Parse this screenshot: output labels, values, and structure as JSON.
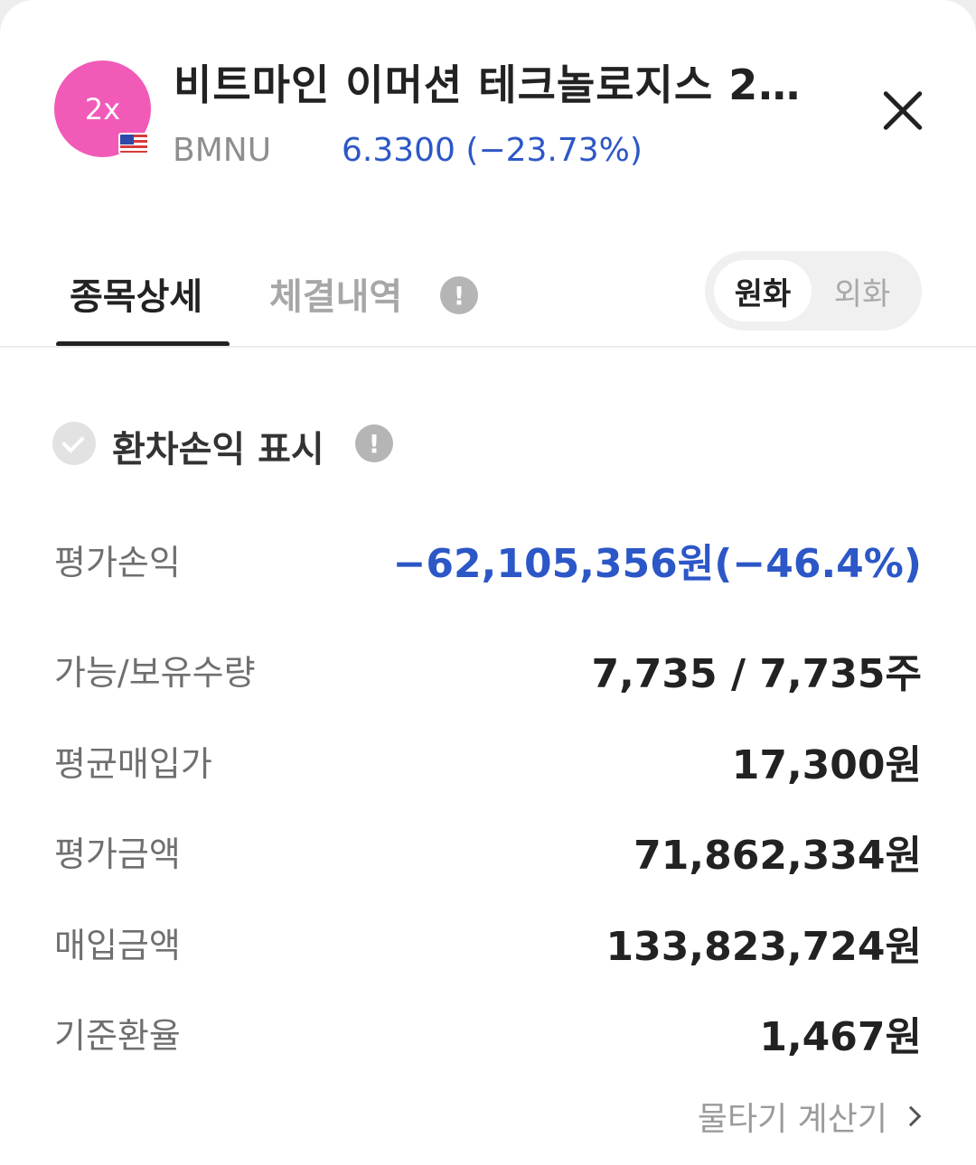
{
  "header": {
    "logo_text": "2x",
    "flag": "us-flag-icon",
    "title": "비트마인 이머션 테크놀로지스 2…",
    "ticker": "BMNU",
    "price_change": "6.3300 (−23.73%)",
    "close_icon": "close-icon"
  },
  "tabs": [
    {
      "label": "종목상세",
      "active": true
    },
    {
      "label": "체결내역",
      "active": false
    }
  ],
  "tab_info_icon": "!",
  "currency_toggle": {
    "options": [
      "원화",
      "외화"
    ],
    "selected": "원화"
  },
  "fx_pnl": {
    "label": "환차손익 표시",
    "checked": false,
    "info_icon": "!"
  },
  "rows": [
    {
      "label": "평가손익",
      "value": "−62,105,356원(−46.4%)"
    },
    {
      "label": "가능/보유수량",
      "value": "7,735 / 7,735주"
    },
    {
      "label": "평균매입가",
      "value": "17,300원"
    },
    {
      "label": "평가금액",
      "value": "71,862,334원"
    },
    {
      "label": "매입금액",
      "value": "133,823,724원"
    },
    {
      "label": "기준환율",
      "value": "1,467원"
    }
  ],
  "calculator_link": "물타기 계산기",
  "colors": {
    "logo": "#f25ab8",
    "negative": "#2c57c7"
  }
}
